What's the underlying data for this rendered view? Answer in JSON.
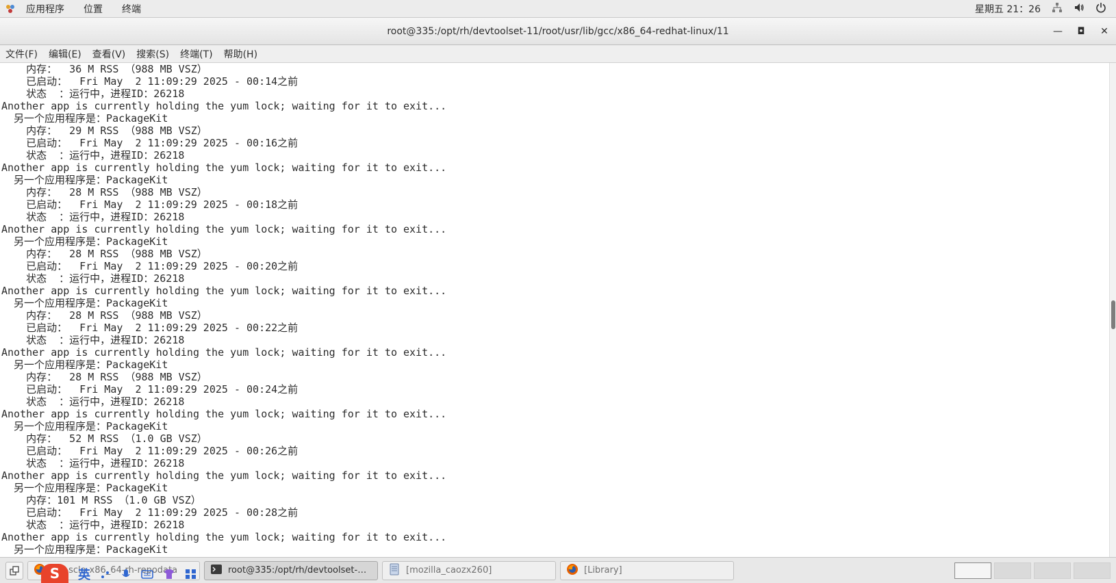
{
  "top_panel": {
    "menu": [
      "应用程序",
      "位置",
      "终端"
    ],
    "clock": "星期五 21：26"
  },
  "window": {
    "title": "root@335:/opt/rh/devtoolset-11/root/usr/lib/gcc/x86_64-redhat-linux/11",
    "minimize": "—",
    "maximize": "◘",
    "close": "✕"
  },
  "menubar": [
    "文件(F)",
    "编辑(E)",
    "查看(V)",
    "搜索(S)",
    "终端(T)",
    "帮助(H)"
  ],
  "terminal": {
    "lines": [
      "    内存：  36 M RSS （988 MB VSZ）",
      "    已启动：  Fri May  2 11:09:29 2025 - 00:14之前",
      "    状态  ：运行中，进程ID：26218",
      "Another app is currently holding the yum lock; waiting for it to exit...",
      "  另一个应用程序是：PackageKit",
      "    内存：  29 M RSS （988 MB VSZ）",
      "    已启动：  Fri May  2 11:09:29 2025 - 00:16之前",
      "    状态  ：运行中，进程ID：26218",
      "Another app is currently holding the yum lock; waiting for it to exit...",
      "  另一个应用程序是：PackageKit",
      "    内存：  28 M RSS （988 MB VSZ）",
      "    已启动：  Fri May  2 11:09:29 2025 - 00:18之前",
      "    状态  ：运行中，进程ID：26218",
      "Another app is currently holding the yum lock; waiting for it to exit...",
      "  另一个应用程序是：PackageKit",
      "    内存：  28 M RSS （988 MB VSZ）",
      "    已启动：  Fri May  2 11:09:29 2025 - 00:20之前",
      "    状态  ：运行中，进程ID：26218",
      "Another app is currently holding the yum lock; waiting for it to exit...",
      "  另一个应用程序是：PackageKit",
      "    内存：  28 M RSS （988 MB VSZ）",
      "    已启动：  Fri May  2 11:09:29 2025 - 00:22之前",
      "    状态  ：运行中，进程ID：26218",
      "Another app is currently holding the yum lock; waiting for it to exit...",
      "  另一个应用程序是：PackageKit",
      "    内存：  28 M RSS （988 MB VSZ）",
      "    已启动：  Fri May  2 11:09:29 2025 - 00:24之前",
      "    状态  ：运行中，进程ID：26218",
      "Another app is currently holding the yum lock; waiting for it to exit...",
      "  另一个应用程序是：PackageKit",
      "    内存：  52 M RSS （1.0 GB VSZ）",
      "    已启动：  Fri May  2 11:09:29 2025 - 00:26之前",
      "    状态  ：运行中，进程ID：26218",
      "Another app is currently holding the yum lock; waiting for it to exit...",
      "  另一个应用程序是：PackageKit",
      "    内存：101 M RSS （1.0 GB VSZ）",
      "    已启动：  Fri May  2 11:09:29 2025 - 00:28之前",
      "    状态  ：运行中，进程ID：26218",
      "Another app is currently holding the yum lock; waiting for it to exit...",
      "  另一个应用程序是：PackageKit"
    ],
    "scroll_position": 0.51
  },
  "taskbar": {
    "tasks": [
      {
        "label": "e 7-sclo-x86_64-rh-repodata",
        "icon": "firefox-icon"
      },
      {
        "label": "root@335:/opt/rh/devtoolset-11/r...",
        "icon": "terminal-icon"
      },
      {
        "label": "[mozilla_caozx260]",
        "icon": "file-manager-icon"
      },
      {
        "label": "[Library]",
        "icon": "firefox-icon"
      }
    ],
    "ime": {
      "lang": "英"
    }
  }
}
